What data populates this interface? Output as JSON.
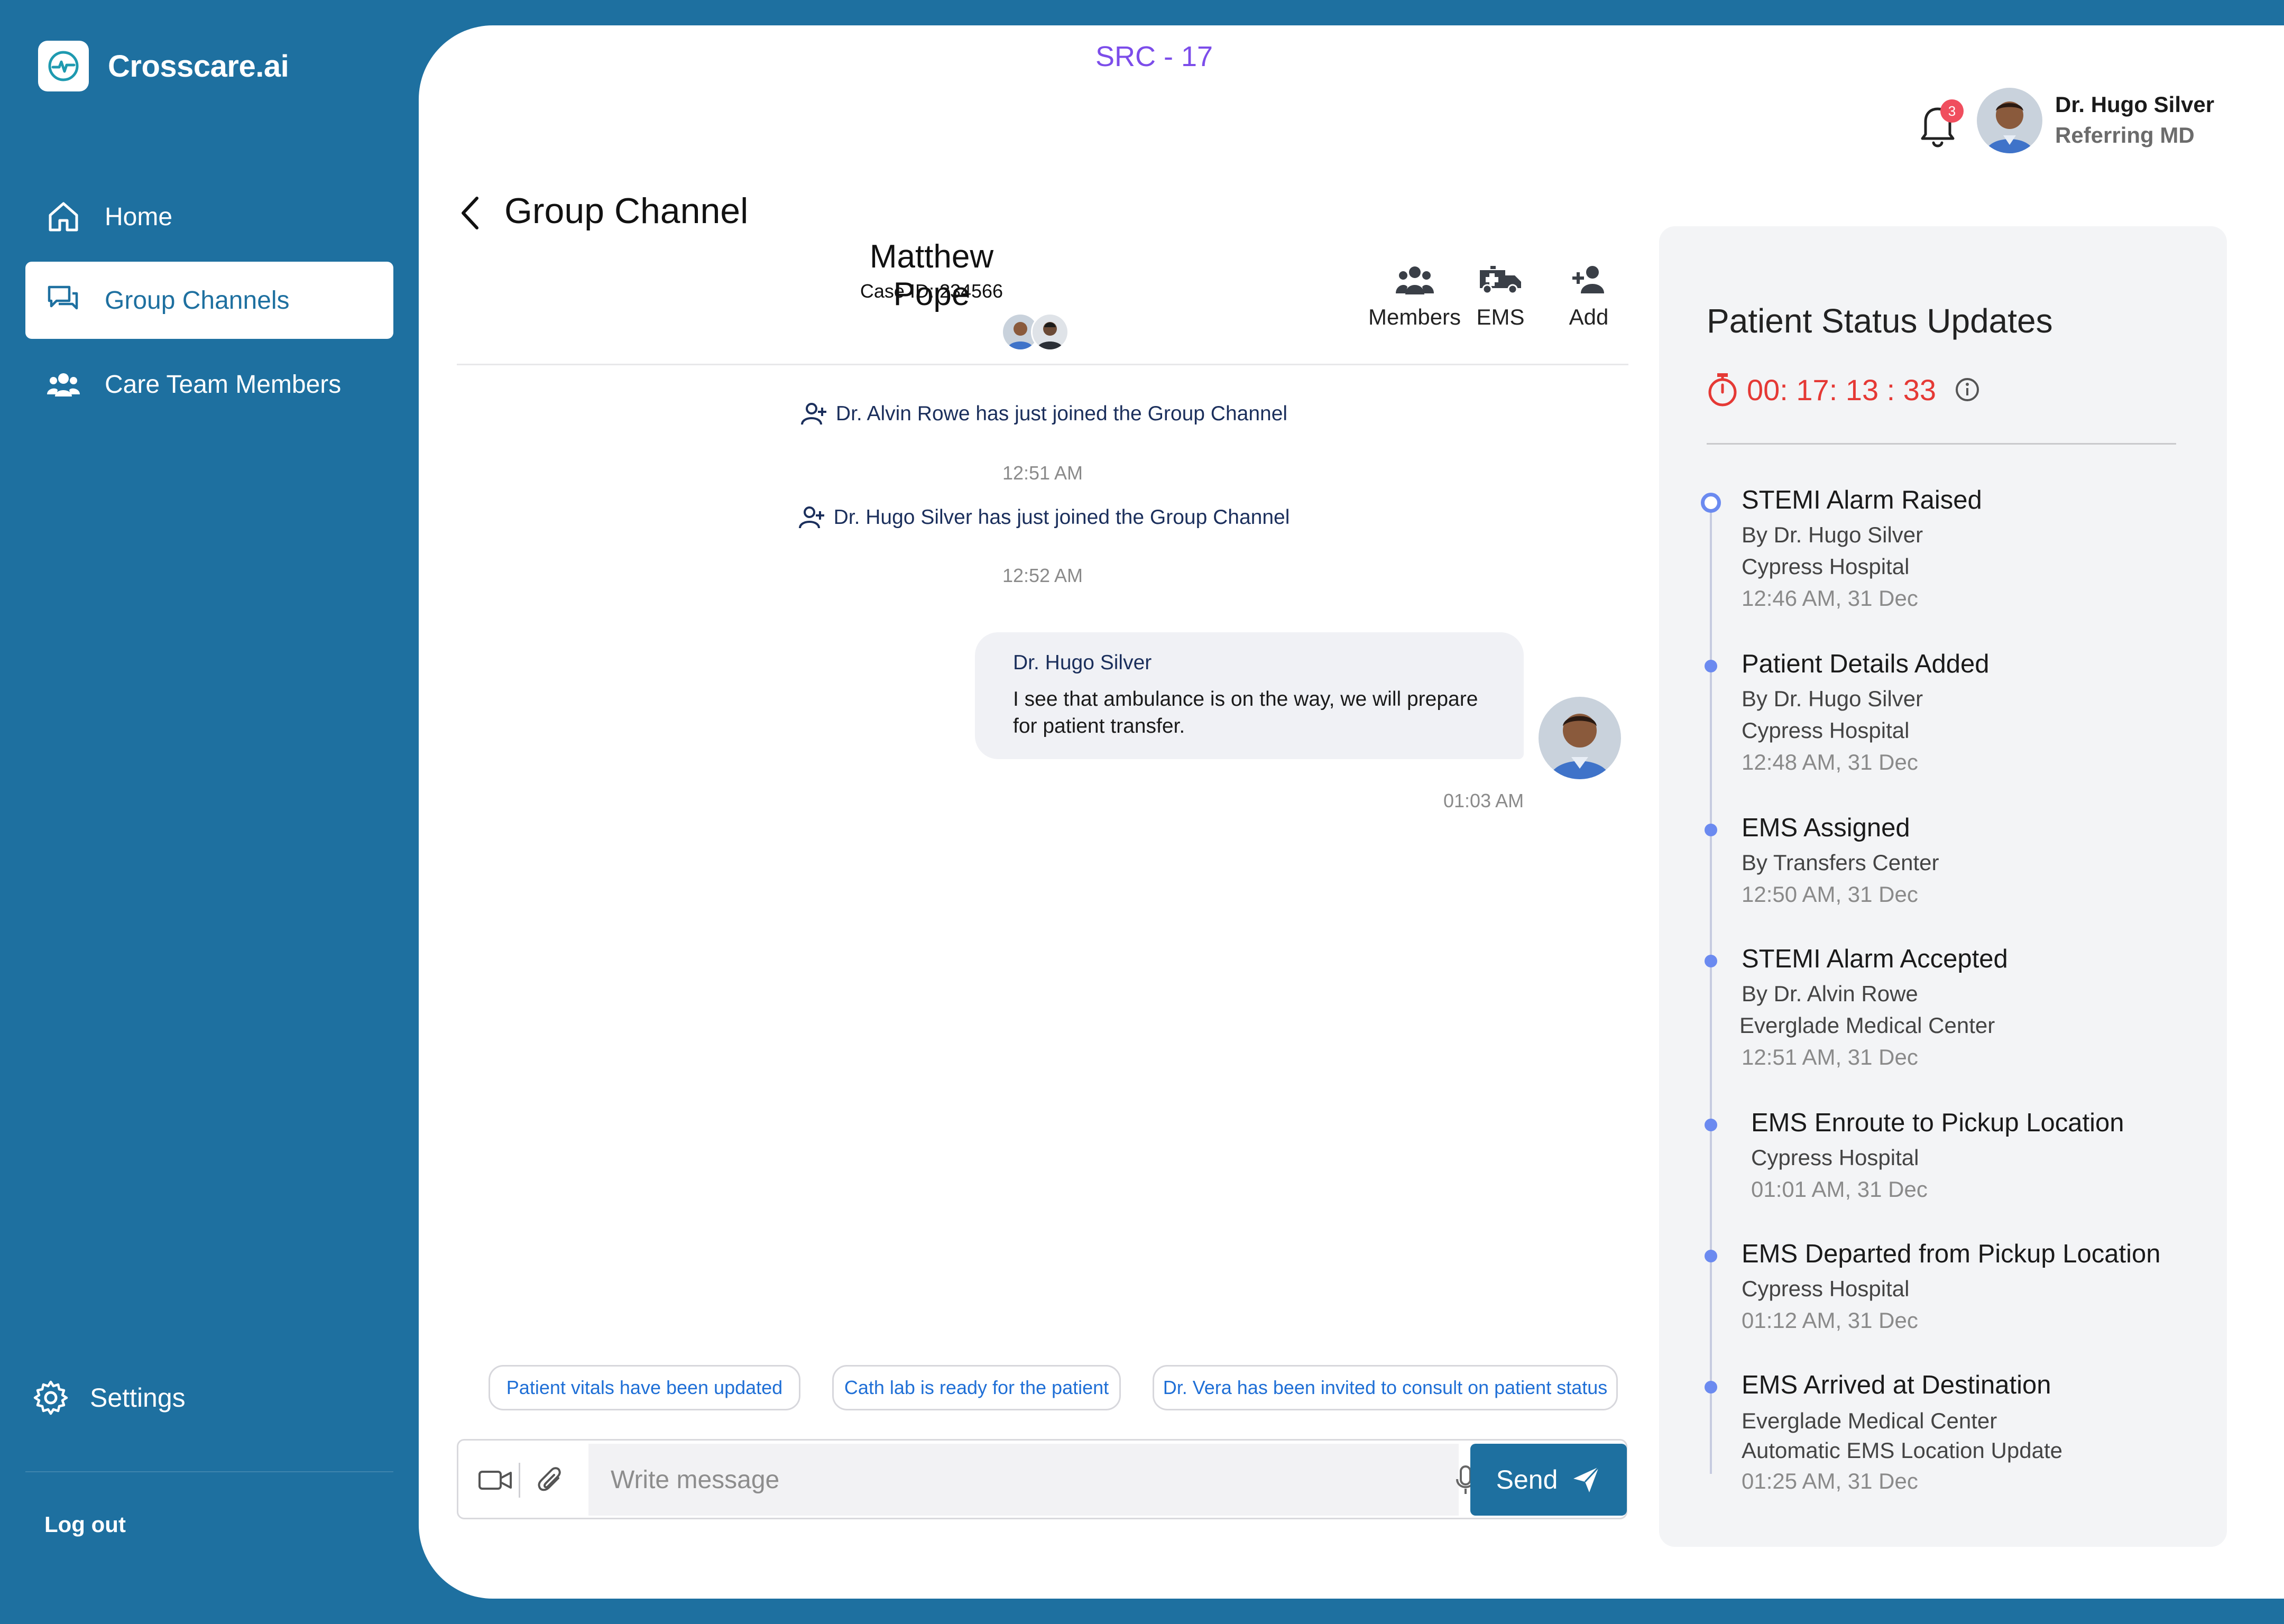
{
  "app": {
    "name": "Crosscare.ai"
  },
  "sidebar": {
    "items": [
      {
        "label": "Home"
      },
      {
        "label": "Group Channels"
      },
      {
        "label": "Care Team Members"
      }
    ],
    "settings_label": "Settings",
    "logout_label": "Log out"
  },
  "topbar": {
    "src_label": "SRC - 17",
    "notification_count": "3",
    "user_name": "Dr. Hugo Silver",
    "user_role": "Referring MD"
  },
  "channel": {
    "title": "Group Channel",
    "patient_name": "Matthew Pope",
    "case_id": "Case ID: 234566",
    "actions": {
      "members": "Members",
      "ems": "EMS",
      "add": "Add"
    }
  },
  "messages": {
    "system": [
      {
        "text": "Dr. Alvin Rowe has just joined the Group Channel",
        "time": "12:51 AM"
      },
      {
        "text": "Dr. Hugo Silver has just joined the Group Channel",
        "time": "12:52 AM"
      }
    ],
    "chat": [
      {
        "sender": "Dr. Hugo Silver",
        "text": "I see that ambulance is on the way, we will prepare for patient transfer.",
        "time": "01:03 AM"
      }
    ]
  },
  "quick_replies": [
    "Patient vitals have been updated",
    "Cath lab is ready for the patient",
    "Dr. Vera has been invited to consult on patient status"
  ],
  "composer": {
    "placeholder": "Write message",
    "send_label": "Send"
  },
  "status_panel": {
    "title": "Patient Status Updates",
    "timer": "00: 17: 13 : 33",
    "events": [
      {
        "title": "STEMI Alarm Raised",
        "lines": [
          "By Dr. Hugo Silver",
          "Cypress Hospital"
        ],
        "time": "12:46 AM, 31 Dec"
      },
      {
        "title": "Patient Details Added",
        "lines": [
          "By Dr. Hugo Silver",
          "Cypress Hospital"
        ],
        "time": "12:48 AM, 31 Dec"
      },
      {
        "title": "EMS Assigned",
        "lines": [
          "By Transfers Center"
        ],
        "time": "12:50 AM, 31 Dec"
      },
      {
        "title": "STEMI Alarm Accepted",
        "lines": [
          "By Dr. Alvin Rowe",
          "Everglade Medical Center"
        ],
        "time": "12:51 AM, 31 Dec"
      },
      {
        "title": "EMS Enroute to Pickup Location",
        "lines": [
          "Cypress Hospital"
        ],
        "time": "01:01 AM, 31 Dec"
      },
      {
        "title": "EMS Departed from Pickup Location",
        "lines": [
          "Cypress Hospital"
        ],
        "time": "01:12 AM, 31 Dec"
      },
      {
        "title": "EMS Arrived at Destination",
        "lines": [
          "Everglade Medical Center",
          "Automatic EMS Location Update"
        ],
        "time": "01:25 AM, 31 Dec"
      }
    ]
  },
  "colors": {
    "brand": "#1e70a0",
    "timer": "#e53935",
    "timeline_dot": "#6b8af0",
    "chip_text": "#1f6fd6",
    "src_label": "#7c4dea"
  },
  "icons": {
    "logo": "heartbeat-icon",
    "home": "home-icon",
    "group_channels": "chat-bubbles-icon",
    "care_team": "people-icon",
    "settings": "gear-icon",
    "notifications": "bell-icon",
    "back": "chevron-left-icon",
    "members": "members-icon",
    "ems": "ambulance-icon",
    "add": "add-user-icon",
    "joined": "user-plus-icon",
    "video": "video-icon",
    "attach": "paperclip-icon",
    "mic": "microphone-icon",
    "send": "paper-plane-icon",
    "timer": "stopwatch-icon",
    "info": "info-icon"
  }
}
